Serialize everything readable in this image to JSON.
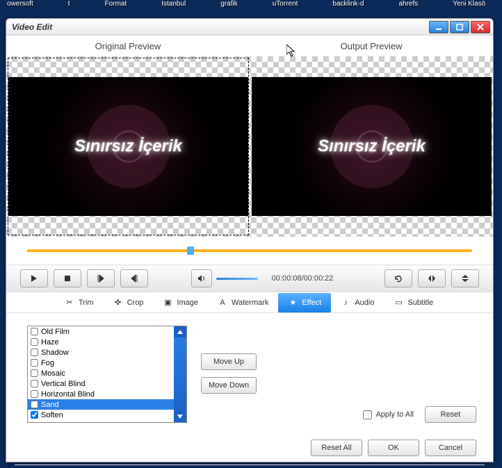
{
  "desktop": {
    "icons": [
      "owersoft",
      "t",
      "Format",
      "İstanbul",
      "grafik",
      "uTorrent",
      "backlink-d",
      "ahrefs",
      "Yeni Klasö"
    ]
  },
  "window": {
    "title": "Video Edit"
  },
  "preview": {
    "original_label": "Original Preview",
    "output_label": "Output Preview",
    "video_text": "Sınırsız İçerik"
  },
  "timecode": "00:00:08/00:00:22",
  "tabs": {
    "trim": "Trim",
    "crop": "Crop",
    "image": "Image",
    "watermark": "Watermark",
    "effect": "Effect",
    "audio": "Audio",
    "subtitle": "Subtitle"
  },
  "effects": {
    "items": [
      {
        "label": "Old Film",
        "checked": false,
        "selected": false
      },
      {
        "label": "Haze",
        "checked": false,
        "selected": false
      },
      {
        "label": "Shadow",
        "checked": false,
        "selected": false
      },
      {
        "label": "Fog",
        "checked": false,
        "selected": false
      },
      {
        "label": "Mosaic",
        "checked": false,
        "selected": false
      },
      {
        "label": "Vertical Blind",
        "checked": false,
        "selected": false
      },
      {
        "label": "Horizontal Blind",
        "checked": false,
        "selected": false
      },
      {
        "label": "Sand",
        "checked": false,
        "selected": true
      },
      {
        "label": "Soften",
        "checked": true,
        "selected": false
      }
    ],
    "move_up": "Move Up",
    "move_down": "Move Down"
  },
  "buttons": {
    "apply_all": "Apply to All",
    "reset": "Reset",
    "reset_all": "Reset All",
    "ok": "OK",
    "cancel": "Cancel"
  }
}
